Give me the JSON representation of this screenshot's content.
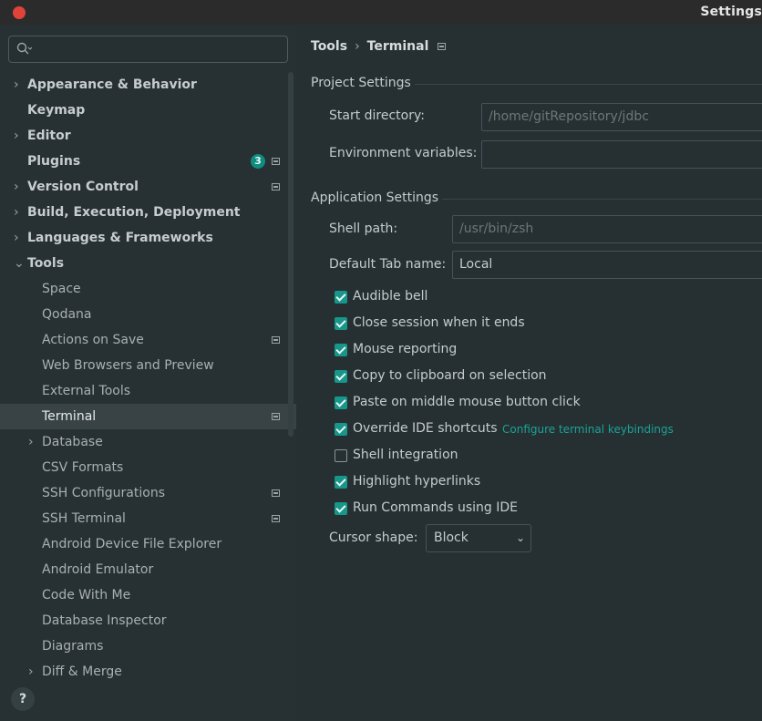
{
  "window": {
    "title": "Settings"
  },
  "sidebar": {
    "search_placeholder": "",
    "items": [
      {
        "label": "Appearance & Behavior",
        "level": 0,
        "chevron": "›"
      },
      {
        "label": "Keymap",
        "level": 0
      },
      {
        "label": "Editor",
        "level": 0,
        "chevron": "›"
      },
      {
        "label": "Plugins",
        "level": 0,
        "badge": "3"
      },
      {
        "label": "Version Control",
        "level": 0,
        "chevron": "›"
      },
      {
        "label": "Build, Execution, Deployment",
        "level": 0,
        "chevron": "›"
      },
      {
        "label": "Languages & Frameworks",
        "level": 0,
        "chevron": "›"
      },
      {
        "label": "Tools",
        "level": 0,
        "chevron": "⌄"
      },
      {
        "label": "Space",
        "level": 1
      },
      {
        "label": "Qodana",
        "level": 1
      },
      {
        "label": "Actions on Save",
        "level": 1
      },
      {
        "label": "Web Browsers and Preview",
        "level": 1
      },
      {
        "label": "External Tools",
        "level": 1
      },
      {
        "label": "Terminal",
        "level": 1,
        "selected": true
      },
      {
        "label": "Database",
        "level": 1,
        "chevron": "›"
      },
      {
        "label": "CSV Formats",
        "level": 1
      },
      {
        "label": "SSH Configurations",
        "level": 1
      },
      {
        "label": "SSH Terminal",
        "level": 1
      },
      {
        "label": "Android Device File Explorer",
        "level": 1
      },
      {
        "label": "Android Emulator",
        "level": 1
      },
      {
        "label": "Code With Me",
        "level": 1
      },
      {
        "label": "Database Inspector",
        "level": 1
      },
      {
        "label": "Diagrams",
        "level": 1
      },
      {
        "label": "Diff & Merge",
        "level": 1,
        "chevron": "›"
      }
    ],
    "help_label": "?"
  },
  "main": {
    "breadcrumb": {
      "parent": "Tools",
      "separator": "›",
      "current": "Terminal"
    },
    "project_settings": {
      "title": "Project Settings",
      "start_directory_label": "Start directory:",
      "start_directory_value": "/home/gitRepository/jdbc",
      "env_vars_label": "Environment variables:",
      "env_vars_value": ""
    },
    "application_settings": {
      "title": "Application Settings",
      "shell_path_label": "Shell path:",
      "shell_path_value": "/usr/bin/zsh",
      "default_tab_label": "Default Tab name:",
      "default_tab_value": "Local",
      "checkboxes": [
        {
          "label": "Audible bell",
          "checked": true
        },
        {
          "label": "Close session when it ends",
          "checked": true
        },
        {
          "label": "Mouse reporting",
          "checked": true
        },
        {
          "label": "Copy to clipboard on selection",
          "checked": true
        },
        {
          "label": "Paste on middle mouse button click",
          "checked": true
        },
        {
          "label": "Override IDE shortcuts",
          "checked": true
        },
        {
          "label": "Shell integration",
          "checked": false
        },
        {
          "label": "Highlight hyperlinks",
          "checked": true
        },
        {
          "label": "Run Commands using IDE",
          "checked": true
        }
      ],
      "configure_link": "Configure terminal keybindings",
      "cursor_shape_label": "Cursor shape:",
      "cursor_shape_value": "Block",
      "cursor_shape_arrow": "⌄"
    }
  },
  "colors": {
    "accent": "#17968a",
    "link": "#19a394",
    "close": "#e0433a"
  }
}
